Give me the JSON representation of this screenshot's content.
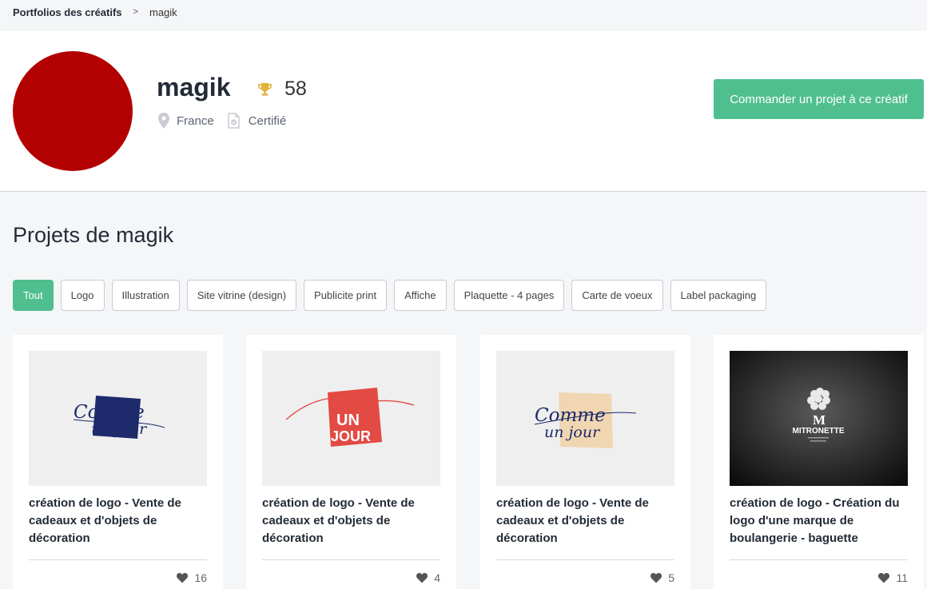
{
  "breadcrumb": {
    "root": "Portfolios des créatifs",
    "separator": ">",
    "current": "magik"
  },
  "profile": {
    "name": "magik",
    "score": "58",
    "location": "France",
    "status": "Certifié",
    "order_button": "Commander un projet à ce créatif",
    "avatar_color": "#b30000"
  },
  "projects": {
    "title": "Projets de magik",
    "filters": [
      "Tout",
      "Logo",
      "Illustration",
      "Site vitrine (design)",
      "Publicite print",
      "Affiche",
      "Plaquette - 4 pages",
      "Carte de voeux",
      "Label packaging"
    ],
    "active_filter": "Tout",
    "cards": [
      {
        "title": "création de logo - Vente de cadeaux et d'objets de décoration",
        "likes": "16",
        "image_text_1": "Comme",
        "image_text_2": "un jour"
      },
      {
        "title": "création de logo - Vente de cadeaux et d'objets de décoration",
        "likes": "4",
        "image_text_1": "UN",
        "image_text_2": "JOUR"
      },
      {
        "title": "création de logo - Vente de cadeaux et d'objets de décoration",
        "likes": "5",
        "image_text_1": "Comme",
        "image_text_2": "un jour"
      },
      {
        "title": "création de logo - Création du logo d'une marque de boulangerie - baguette",
        "likes": "11",
        "image_text_1": "MITRONETTE",
        "image_text_2": ""
      }
    ]
  },
  "colors": {
    "accent": "#4fbf8f",
    "trophy": "#e2b23f",
    "text": "#222b36"
  }
}
